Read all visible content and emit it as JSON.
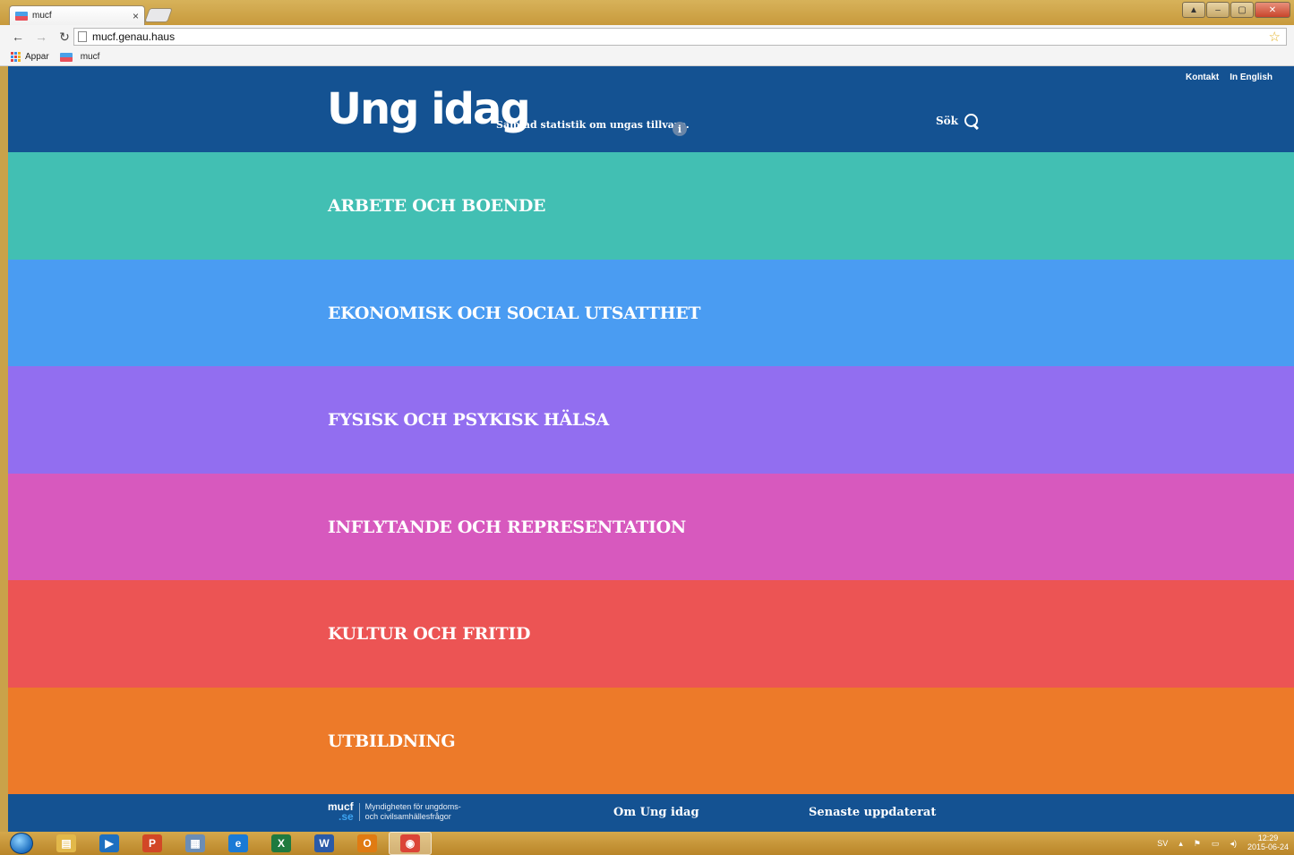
{
  "browser": {
    "tab_title": "mucf",
    "tab_close": "×",
    "url": "mucf.genau.haus",
    "bookmarks": [
      {
        "label": "Appar"
      },
      {
        "label": "mucf"
      }
    ]
  },
  "site": {
    "top_links": {
      "contact": "Kontakt",
      "english": "In English"
    },
    "logo": "Ung idag",
    "tagline": "Samlad statistik om ungas tillvaro.",
    "info_glyph": "i",
    "search_label": "Sök",
    "categories": [
      {
        "label": "ARBETE OCH BOENDE",
        "color": "#42bfb3"
      },
      {
        "label": "EKONOMISK OCH SOCIAL UTSATTHET",
        "color": "#4a9cf2"
      },
      {
        "label": "FYSISK OCH PSYKISK HÄLSA",
        "color": "#926ef0"
      },
      {
        "label": "INFLYTANDE OCH REPRESENTATION",
        "color": "#d759be"
      },
      {
        "label": "KULTUR OCH FRITID",
        "color": "#ec5454"
      },
      {
        "label": "UTBILDNING",
        "color": "#ed7a29"
      }
    ],
    "header_color": "#145292",
    "footer": {
      "mucf_mark": "mucf",
      "mucf_se": ".se",
      "mucf_line1": "Myndigheten för ungdoms-",
      "mucf_line2": "och civilsamhällesfrågor",
      "about": "Om Ung idag",
      "latest": "Senaste uppdaterat"
    }
  },
  "taskbar": {
    "language": "SV",
    "time": "12:29",
    "date": "2015-06-24",
    "apps": [
      {
        "icon": "explorer-icon",
        "glyph": "▤",
        "color": "#e2b84a"
      },
      {
        "icon": "media-player-icon",
        "glyph": "▶",
        "color": "#1e6fc0"
      },
      {
        "icon": "powerpoint-icon",
        "glyph": "P",
        "color": "#d24726"
      },
      {
        "icon": "calculator-icon",
        "glyph": "▦",
        "color": "#6b8db5"
      },
      {
        "icon": "internet-explorer-icon",
        "glyph": "e",
        "color": "#1a7ad6"
      },
      {
        "icon": "excel-icon",
        "glyph": "X",
        "color": "#1f7a3f"
      },
      {
        "icon": "word-icon",
        "glyph": "W",
        "color": "#2a5aa8"
      },
      {
        "icon": "outlook-icon",
        "glyph": "O",
        "color": "#e07b12"
      },
      {
        "icon": "chrome-icon",
        "glyph": "◉",
        "color": "#db4437"
      }
    ]
  }
}
